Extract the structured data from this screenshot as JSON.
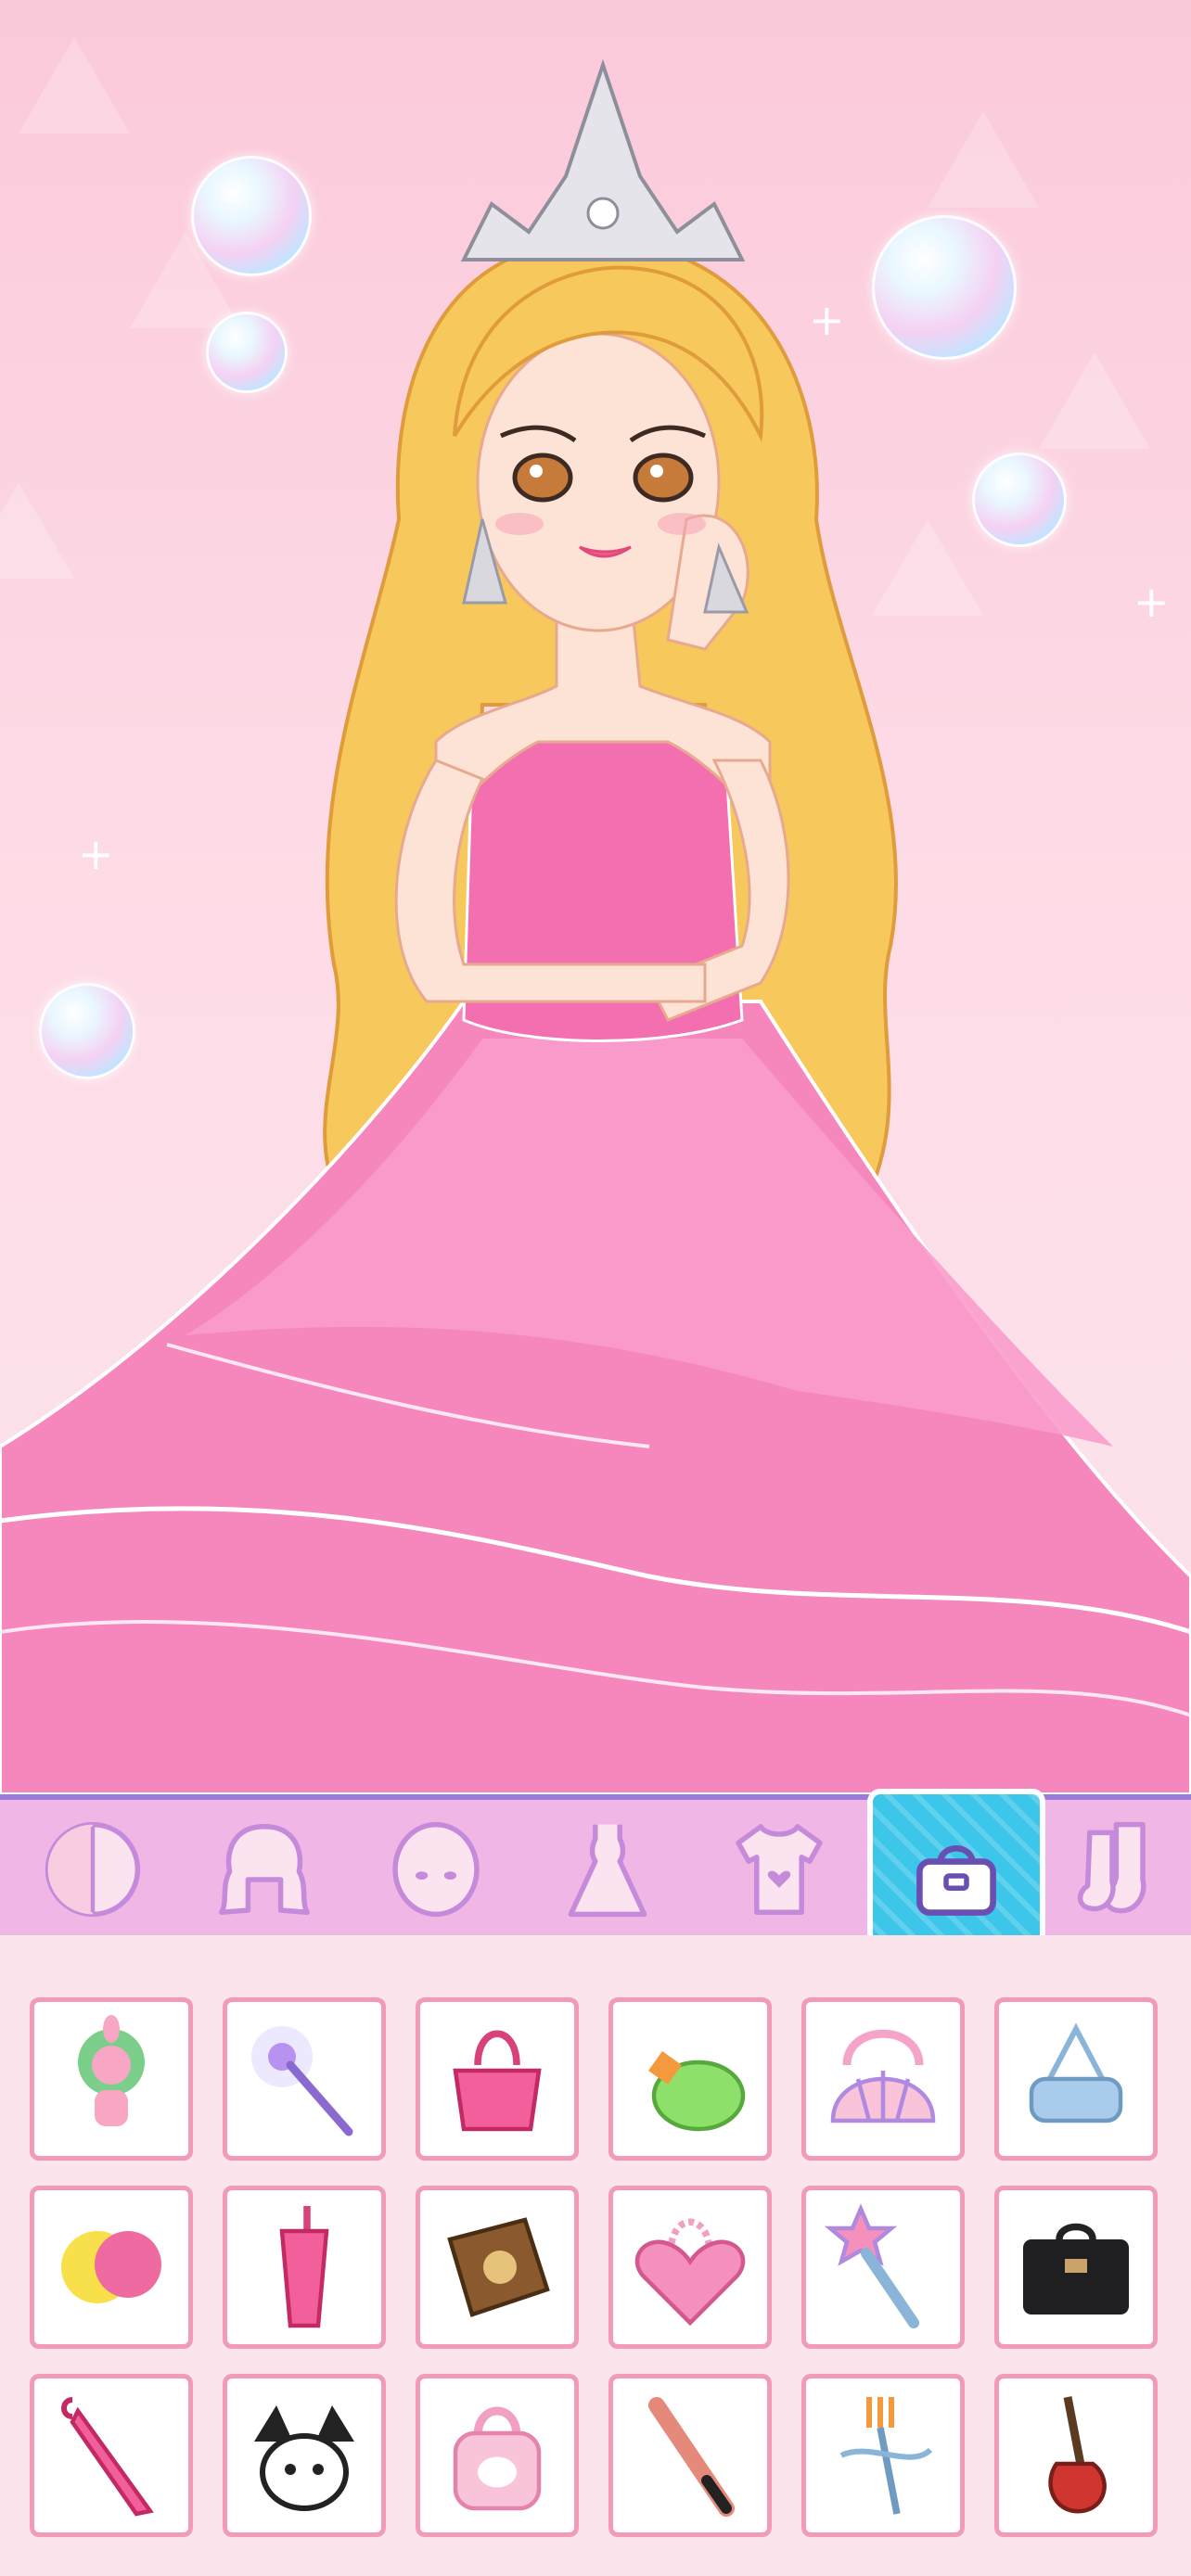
{
  "game": {
    "character": "princess-avatar",
    "dress_color": "#f46fb0",
    "hair_color": "#f7c85b"
  },
  "categories": [
    {
      "icon": "skin-tone-icon",
      "active": false
    },
    {
      "icon": "hair-icon",
      "active": false
    },
    {
      "icon": "face-icon",
      "active": false
    },
    {
      "icon": "dress-icon",
      "active": false
    },
    {
      "icon": "top-shirt-icon",
      "active": false
    },
    {
      "icon": "handbag-icon",
      "active": true
    },
    {
      "icon": "socks-icon",
      "active": false
    }
  ],
  "items": [
    "pink-lion-plush-item",
    "magic-wand-item",
    "pink-heart-bag-item",
    "green-coconut-bag-item",
    "seashell-bag-item",
    "blue-shoulder-bag-item",
    "pompom-item",
    "pink-tumbler-item",
    "spell-book-item",
    "pink-quilted-bag-item",
    "star-wand-item",
    "black-briefcase-item",
    "pink-umbrella-item",
    "kuromi-bag-item",
    "hello-kitty-bag-item",
    "baseball-bat-item",
    "fancy-fork-wand-item",
    "electric-guitar-item"
  ],
  "colors": {
    "tabbar_bg": "#f0b7e6",
    "tab_active_bg": "#3cc6e9",
    "cell_border": "#f39ab8",
    "accent_purple": "#9b7bd9"
  }
}
